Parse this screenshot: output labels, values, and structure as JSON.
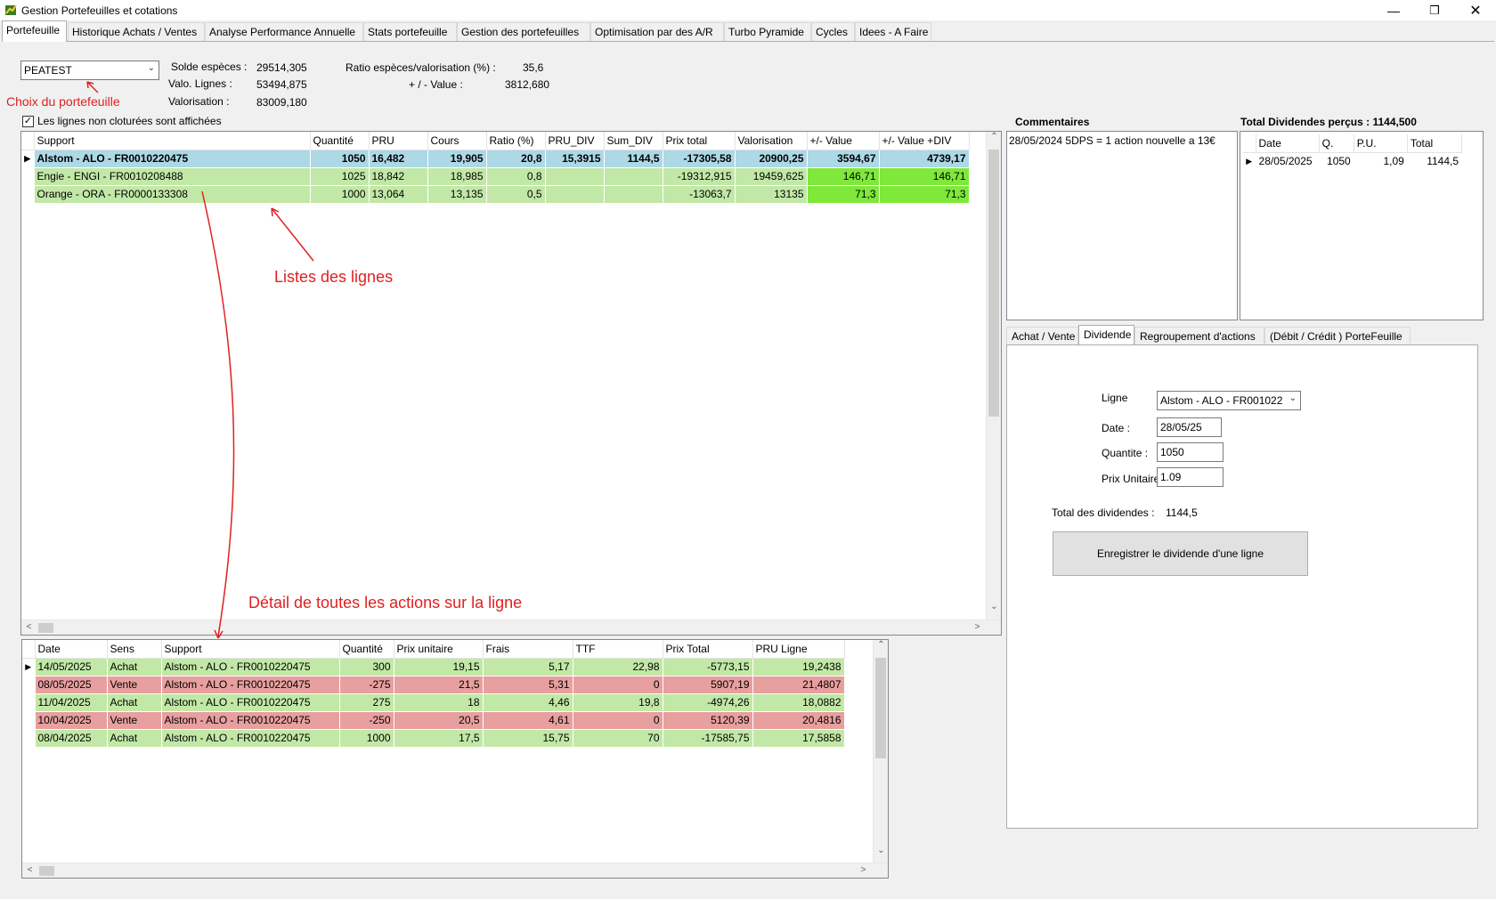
{
  "window": {
    "title": "Gestion Portefeuilles et cotations"
  },
  "tabs": [
    "Portefeuille",
    "Historique Achats / Ventes",
    "Analyse Performance Annuelle",
    "Stats portefeuille",
    "Gestion des portefeuilles",
    "Optimisation par des A/R",
    "Turbo Pyramide",
    "Cycles",
    "Idees - A Faire"
  ],
  "portfolio": {
    "selected": "PEATEST",
    "label_solde": "Solde espèces :",
    "solde": "29514,305",
    "label_valo_lignes": "Valo. Lignes :",
    "valo_lignes": "53494,875",
    "label_valorisation": "Valorisation :",
    "valorisation": "83009,180",
    "label_ratio": "Ratio espèces/valorisation (%) :",
    "ratio": "35,6",
    "label_pv": "+ / -  Value :",
    "pv": "3812,680",
    "checkbox_label": "Les lignes non cloturées sont affichées"
  },
  "annotations": {
    "choix": "Choix du portefeuille",
    "listes": "Listes des lignes",
    "detail": "Détail de toutes les actions sur la ligne"
  },
  "lines_grid": {
    "headers": [
      "Support",
      "Quantité",
      "PRU",
      "Cours",
      "Ratio (%)",
      "PRU_DIV",
      "Sum_DIV",
      "Prix total",
      "Valorisation",
      "+/- Value",
      "+/- Value +DIV"
    ],
    "rows": [
      [
        "Alstom - ALO - FR0010220475",
        "1050",
        "16,482",
        "19,905",
        "20,8",
        "15,3915",
        "1144,5",
        "-17305,58",
        "20900,25",
        "3594,67",
        "4739,17"
      ],
      [
        "Engie - ENGI - FR0010208488",
        "1025",
        "18,842",
        "18,985",
        "0,8",
        "",
        "",
        "-19312,915",
        "19459,625",
        "146,71",
        "146,71"
      ],
      [
        "Orange - ORA - FR0000133308",
        "1000",
        "13,064",
        "13,135",
        "0,5",
        "",
        "",
        "-13063,7",
        "13135",
        "71,3",
        "71,3"
      ]
    ]
  },
  "detail_grid": {
    "headers": [
      "Date",
      "Sens",
      "Support",
      "Quantité",
      "Prix unitaire",
      "Frais",
      "TTF",
      "Prix Total",
      "PRU Ligne"
    ],
    "rows": [
      [
        "14/05/2025",
        "Achat",
        "Alstom - ALO - FR0010220475",
        "300",
        "19,15",
        "5,17",
        "22,98",
        "-5773,15",
        "19,2438"
      ],
      [
        "08/05/2025",
        "Vente",
        "Alstom - ALO - FR0010220475",
        "-275",
        "21,5",
        "5,31",
        "0",
        "5907,19",
        "21,4807"
      ],
      [
        "11/04/2025",
        "Achat",
        "Alstom - ALO - FR0010220475",
        "275",
        "18",
        "4,46",
        "19,8",
        "-4974,26",
        "18,0882"
      ],
      [
        "10/04/2025",
        "Vente",
        "Alstom - ALO - FR0010220475",
        "-250",
        "20,5",
        "4,61",
        "0",
        "5120,39",
        "20,4816"
      ],
      [
        "08/04/2025",
        "Achat",
        "Alstom - ALO - FR0010220475",
        "1000",
        "17,5",
        "15,75",
        "70",
        "-17585,75",
        "17,5858"
      ]
    ]
  },
  "comments": {
    "title": "Commentaires",
    "text": "28/05/2024 5DPS = 1 action nouvelle a 13€"
  },
  "dividends": {
    "title": "Total Dividendes perçus : 1144,500",
    "headers": [
      "Date",
      "Q.",
      "P.U.",
      "Total"
    ],
    "rows": [
      [
        "28/05/2025",
        "1050",
        "1,09",
        "1144,5"
      ]
    ]
  },
  "subtabs": [
    "Achat / Vente",
    "Dividende",
    "Regroupement d'actions",
    "(Débit / Crédit ) PorteFeuille"
  ],
  "dividend_form": {
    "label_ligne": "Ligne",
    "ligne": "Alstom - ALO - FR001022",
    "label_date": "Date :",
    "date": "28/05/25",
    "label_quantite": "Quantite :",
    "quantite": "1050",
    "label_prix": "Prix Unitaire",
    "prix": "1.09",
    "label_total": "Total des dividendes :",
    "total": "1144,5",
    "button": "Enregistrer le dividende d'une ligne"
  }
}
